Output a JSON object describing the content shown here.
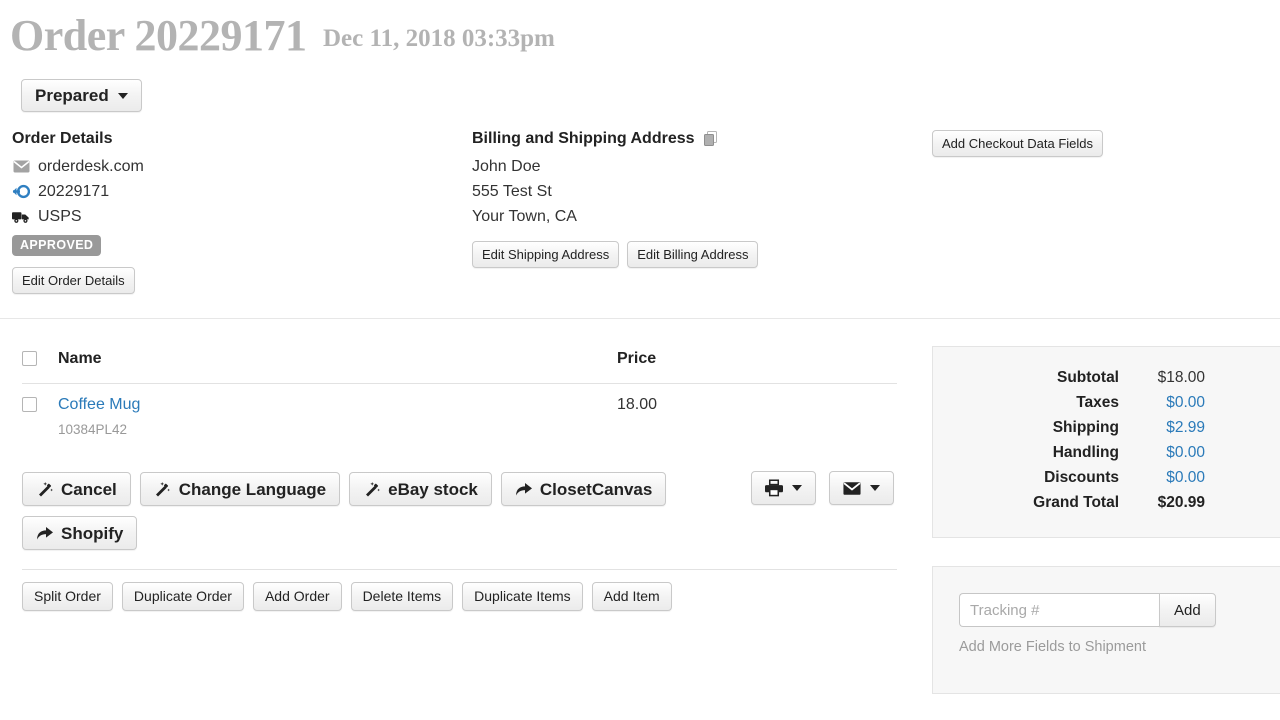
{
  "header": {
    "title": "Order 20229171",
    "date": "Dec 11, 2018 03:33pm",
    "status_button": "Prepared"
  },
  "order_details": {
    "heading": "Order Details",
    "source": "orderdesk.com",
    "order_number": "20229171",
    "carrier": "USPS",
    "badge": "APPROVED",
    "edit_button": "Edit Order Details"
  },
  "address": {
    "heading": "Billing and Shipping Address",
    "name": "John Doe",
    "street": "555 Test St",
    "city_state": "Your Town, CA",
    "edit_shipping_button": "Edit Shipping Address",
    "edit_billing_button": "Edit Billing Address"
  },
  "checkout": {
    "add_fields_button": "Add Checkout Data Fields"
  },
  "items_table": {
    "columns": [
      "Name",
      "Price"
    ],
    "rows": [
      {
        "name": "Coffee Mug",
        "sku": "10384PL42",
        "price": "18.00"
      }
    ]
  },
  "actions": {
    "row1": [
      {
        "label": "Cancel",
        "icon": "magic-wand-icon"
      },
      {
        "label": "Change Language",
        "icon": "magic-wand-icon"
      },
      {
        "label": "eBay stock",
        "icon": "magic-wand-icon"
      },
      {
        "label": "ClosetCanvas",
        "icon": "share-arrow-icon"
      }
    ],
    "row2": [
      {
        "label": "Shopify",
        "icon": "share-arrow-icon"
      }
    ],
    "row3": [
      "Split Order",
      "Duplicate Order",
      "Add Order",
      "Delete Items",
      "Duplicate Items",
      "Add Item"
    ],
    "print_icon": "printer-icon",
    "email_icon": "envelope-icon"
  },
  "totals": {
    "rows": [
      {
        "label": "Subtotal",
        "value": "$18.00",
        "style": "plain"
      },
      {
        "label": "Taxes",
        "value": "$0.00",
        "style": "link"
      },
      {
        "label": "Shipping",
        "value": "$2.99",
        "style": "link"
      },
      {
        "label": "Handling",
        "value": "$0.00",
        "style": "link"
      },
      {
        "label": "Discounts",
        "value": "$0.00",
        "style": "link"
      },
      {
        "label": "Grand Total",
        "value": "$20.99",
        "style": "strong"
      }
    ]
  },
  "tracking": {
    "placeholder": "Tracking #",
    "value": "",
    "add_button": "Add",
    "more_fields_link": "Add More Fields to Shipment"
  },
  "colors": {
    "link_blue": "#2a7ab9",
    "title_gray": "#b3b3b3",
    "badge_gray": "#999999",
    "panel_bg": "#f7f7f7"
  }
}
